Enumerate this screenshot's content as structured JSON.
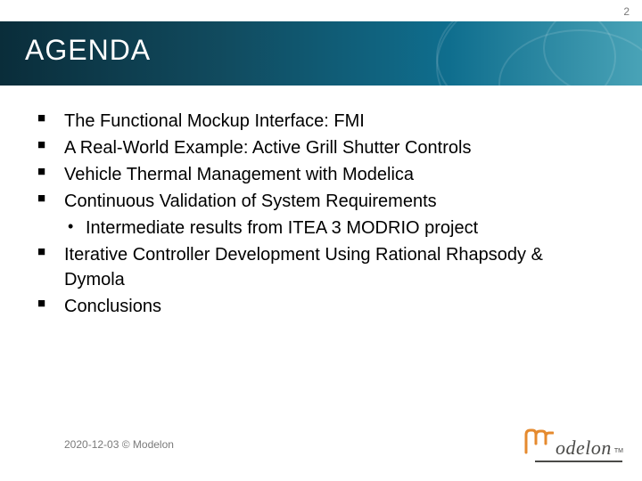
{
  "page_number": "2",
  "title": "AGENDA",
  "items": [
    {
      "text": "The Functional Mockup Interface: FMI",
      "sub": []
    },
    {
      "text": "A Real-World Example: Active Grill Shutter Controls",
      "sub": []
    },
    {
      "text": "Vehicle Thermal Management with Modelica",
      "sub": []
    },
    {
      "text": "Continuous Validation of System Requirements",
      "sub": [
        "Intermediate results from ITEA 3 MODRIO project"
      ]
    },
    {
      "text": "Iterative Controller Development Using Rational Rhapsody & Dymola",
      "sub": []
    },
    {
      "text": "Conclusions",
      "sub": []
    }
  ],
  "footer": "2020-12-03 © Modelon",
  "logo": {
    "brand": "odelon",
    "tm": "TM"
  },
  "colors": {
    "band_dark": "#0a2d3a",
    "band_light": "#49a3b7",
    "accent_orange": "#e58a2e",
    "logo_gray": "#4a4a48"
  }
}
